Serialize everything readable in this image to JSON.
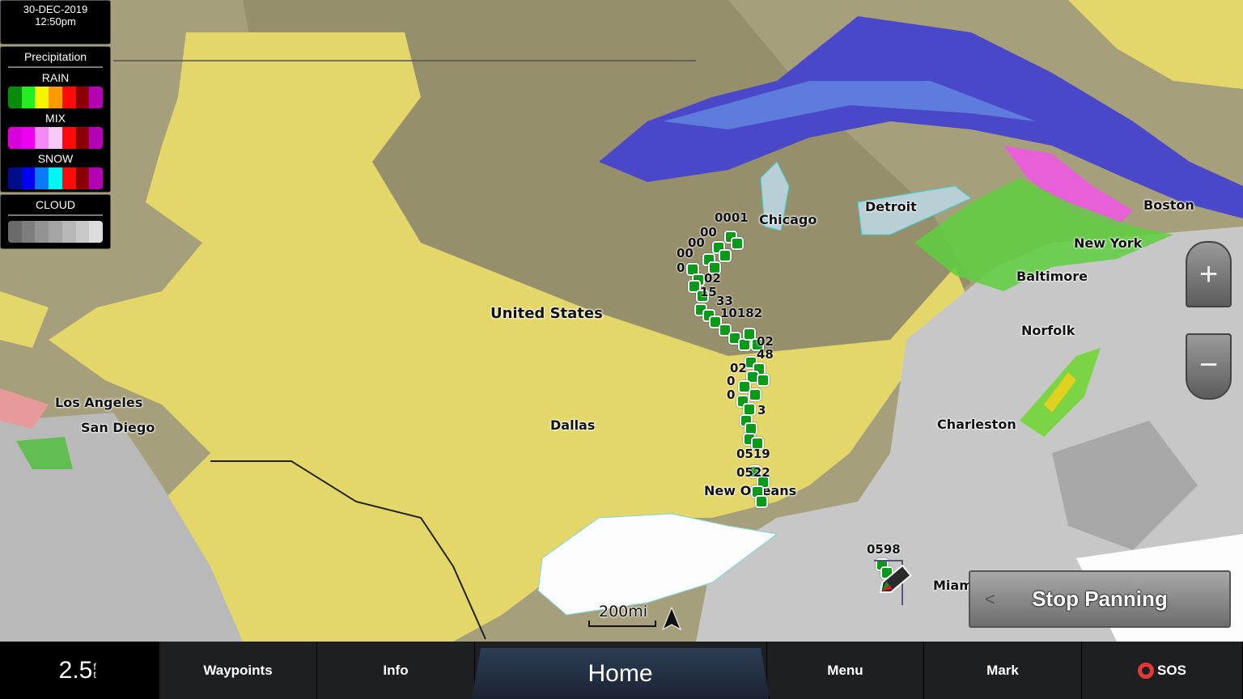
{
  "datetime": {
    "date": "30-DEC-2019",
    "time": "12:50pm"
  },
  "legend": {
    "title": "Precipitation",
    "rain": {
      "label": "RAIN",
      "colors": [
        "#0a8a0a",
        "#22ee22",
        "#f5f500",
        "#ff9a00",
        "#ff0a0a",
        "#8a0000",
        "#b400b4"
      ]
    },
    "mix": {
      "label": "MIX",
      "colors": [
        "#d800d8",
        "#ee00ee",
        "#f58af5",
        "#f8c8f8",
        "#ff0a0a",
        "#8a0000",
        "#b400b4"
      ]
    },
    "snow": {
      "label": "SNOW",
      "colors": [
        "#000c8a",
        "#0000f5",
        "#0a7af5",
        "#00f5f5",
        "#ff0a0a",
        "#8a0000",
        "#b400b4"
      ]
    },
    "cloud": {
      "label": "CLOUD",
      "colors": [
        "#6a6a6a",
        "#7e7e7e",
        "#939393",
        "#a5a5a5",
        "#b8b8b8",
        "#c9c9c9",
        "#dcdcdc"
      ]
    }
  },
  "map": {
    "country": "United States",
    "cities": [
      "Chicago",
      "Detroit",
      "Boston",
      "New York",
      "Baltimore",
      "Norfolk",
      "Charleston",
      "Los Angeles",
      "San Diego",
      "Dallas",
      "New Orleans",
      "Miami"
    ],
    "waypoint_labels": [
      "0001",
      "00",
      "00",
      "00",
      "0",
      "02",
      "15",
      "33",
      "10182",
      "02",
      "48",
      "02",
      "0",
      "0",
      "3",
      "0519",
      "0522",
      "0598"
    ],
    "scale": "200mi",
    "north_icon": "north-arrow-icon",
    "vessel_icon": "boat-icon"
  },
  "controls": {
    "zoom_in": "+",
    "zoom_out": "−",
    "stop_panning": "Stop Panning",
    "back_chevron": "<"
  },
  "bottom_bar": {
    "depth_value": "2.5",
    "depth_unit_top": "f",
    "depth_unit_bottom": "t",
    "items": [
      "Waypoints",
      "Info",
      "Home",
      "Menu",
      "Mark",
      "SOS"
    ]
  }
}
